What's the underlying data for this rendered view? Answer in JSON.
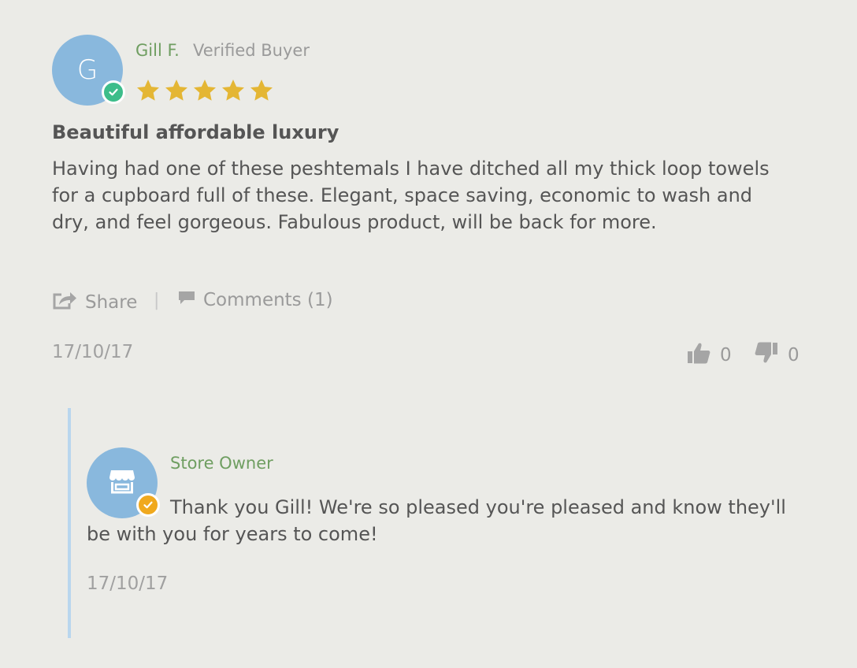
{
  "review": {
    "avatar_letter": "G",
    "author": "Gill F.",
    "buyer_status": "Verified Buyer",
    "rating": 5,
    "rating_max": 5,
    "star_color": "#e4b634",
    "verified_badge_color": "#3dbd8a",
    "title": "Beautiful affordable luxury",
    "body": "Having had one of these peshtemals I have ditched all my thick loop towels for a cupboard full of these. Elegant, space saving, economic to wash and dry, and feel gorgeous. Fabulous product, will be back for more.",
    "actions": {
      "share_label": "Share",
      "separator": "|",
      "comments_label": "Comments (1)"
    },
    "date": "17/10/17",
    "votes": {
      "up_count": "0",
      "down_count": "0"
    }
  },
  "reply": {
    "avatar_icon": "store-icon",
    "badge_color": "#f0a91e",
    "author": "Store Owner",
    "body": "Thank you Gill! We're so pleased you're pleased and know they'll be with you for years to come!",
    "date": "17/10/17"
  },
  "colors": {
    "background": "#ebebe7",
    "avatar": "#89b8dd",
    "name": "#6f9e61",
    "reply_bar": "#b9d6ee"
  }
}
